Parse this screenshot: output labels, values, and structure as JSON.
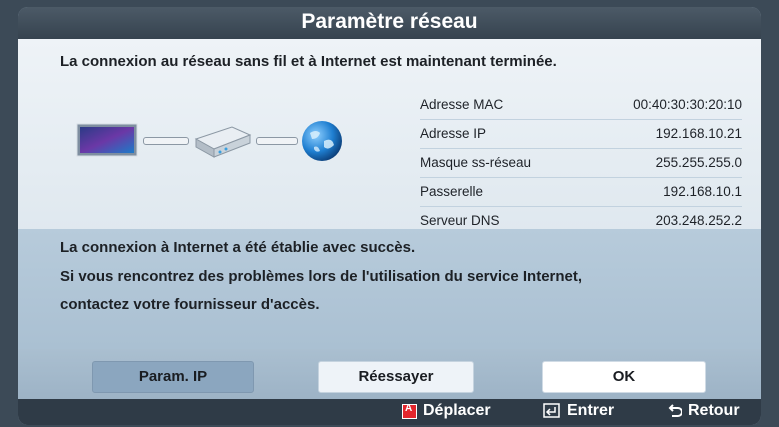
{
  "dialog": {
    "title": "Paramètre réseau",
    "headline": "La connexion au réseau sans fil et à Internet est maintenant terminée.",
    "info": [
      {
        "label": "Adresse MAC",
        "value": "00:40:30:30:20:10"
      },
      {
        "label": "Adresse IP",
        "value": "192.168.10.21"
      },
      {
        "label": "Masque ss-réseau",
        "value": "255.255.255.0"
      },
      {
        "label": "Passerelle",
        "value": "192.168.10.1"
      },
      {
        "label": "Serveur DNS",
        "value": "203.248.252.2"
      }
    ],
    "messages": [
      "La connexion à Internet a été établie avec succès.",
      "Si vous rencontrez des problèmes lors de l'utilisation du service Internet,",
      "contactez votre fournisseur d'accès."
    ],
    "buttons": {
      "ip": "Param. IP",
      "retry": "Réessayer",
      "ok": "OK"
    },
    "hints": {
      "move": "Déplacer",
      "enter": "Entrer",
      "back": "Retour"
    },
    "colors": {
      "title_bg": "#3f4c59",
      "panel_bg": "#e6eef4",
      "selected_button": "#8ba6bf",
      "red_key": "#e3262d"
    },
    "icons": [
      "tv-icon",
      "router-icon",
      "globe-icon",
      "enter-icon",
      "return-icon"
    ]
  }
}
